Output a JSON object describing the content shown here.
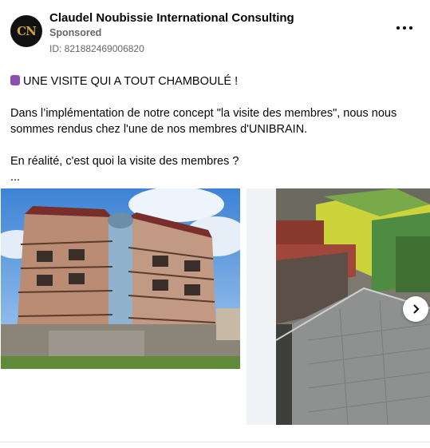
{
  "post": {
    "page_name": "Claudel Noubissie International Consulting",
    "sponsored": "Sponsored",
    "ad_id": "ID: 821882469006820",
    "avatar_monogram": "CN",
    "more_icon": "ellipsis-icon"
  },
  "body": {
    "headline": "UNE VISITE QUI A TOUT CHAMBOULÉ !",
    "headline_icon": "purple-emoji-icon",
    "paragraph1": "Dans l’implémentation de notre concept \"la visite des membres\", nous nous sommes rendus chez l'une de nos membres d'UNIBRAIN.",
    "paragraph2": "En réalité, c'est quoi la visite des membres ?",
    "ellipsis": "..."
  },
  "carousel": {
    "next_icon": "chevron-right-icon",
    "slides": [
      {
        "name": "building-under-construction-photo"
      },
      {
        "name": "rooftop-aerial-photo"
      }
    ]
  },
  "colors": {
    "secondary_text": "#65676b",
    "divider": "#e4e6eb",
    "gap_bg": "#f0f2f5"
  }
}
